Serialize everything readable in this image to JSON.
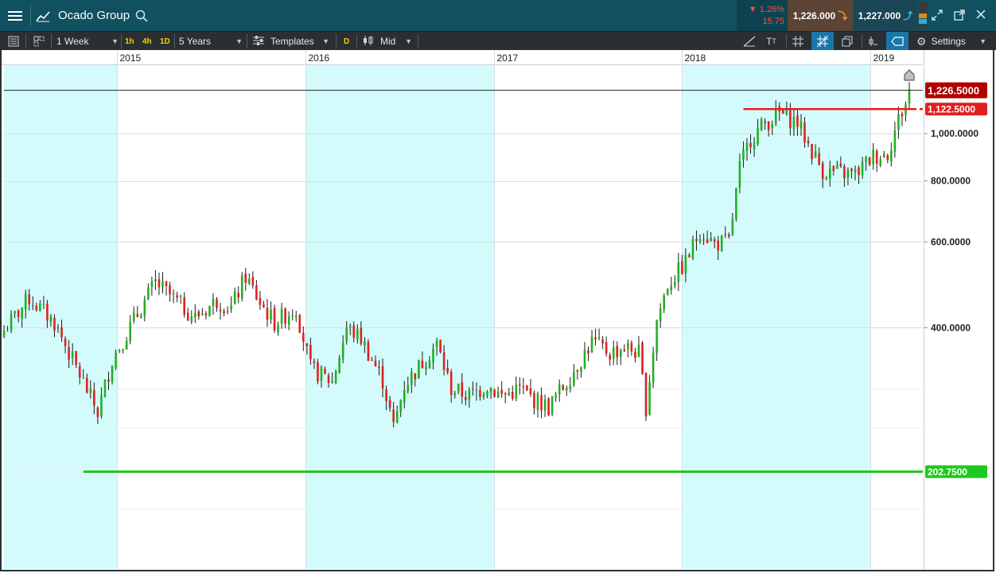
{
  "header": {
    "title": "Ocado Group",
    "change_percent": "▼ 1.26%",
    "change_value": "15.75",
    "sell_price": "1,226.000",
    "buy_price": "1,227.000"
  },
  "toolbar": {
    "period": "1 Week",
    "interval_1h": "1h",
    "interval_4h": "4h",
    "interval_1d": "1D",
    "range": "5 Years",
    "templates": "Templates",
    "d_label": "D",
    "price_type": "Mid",
    "settings": "Settings"
  },
  "colors": {
    "header_bg": "#11505f",
    "up": "#22b022",
    "down": "#e02020",
    "shade": "#d4fbfc",
    "support": "#1ec81e",
    "resistance": "#e02020",
    "current": "#b00000"
  },
  "chart_data": {
    "type": "candlestick",
    "title": "",
    "y_scale": "log",
    "ylim": [
      140,
      1400
    ],
    "y_ticks": [
      "1,000.0000",
      "800.0000",
      "600.0000",
      "400.0000"
    ],
    "y_tick_values": [
      1000,
      800,
      600,
      400
    ],
    "x_labels": [
      "2015",
      "2016",
      "2017",
      "2018",
      "2019"
    ],
    "x_label_dates": [
      "2015-01-01",
      "2016-01-01",
      "2017-01-01",
      "2018-01-01",
      "2019-01-01"
    ],
    "date_range": [
      "2014-05-26",
      "2019-03-18"
    ],
    "shaded_years": [
      "2016",
      "2018"
    ],
    "labels": {
      "current_price": "1,226.5000",
      "current_price_value": 1226.5,
      "resistance": "1,122.5000",
      "resistance_value": 1122.5,
      "support": "202.7500",
      "support_value": 202.75
    },
    "weekly_closes_anchor": [
      [
        "2014-05-26",
        395
      ],
      [
        "2014-07-14",
        460
      ],
      [
        "2014-09-01",
        410
      ],
      [
        "2014-10-20",
        320
      ],
      [
        "2014-11-24",
        268
      ],
      [
        "2014-12-22",
        345
      ],
      [
        "2015-02-16",
        440
      ],
      [
        "2015-03-16",
        495
      ],
      [
        "2015-05-04",
        445
      ],
      [
        "2015-06-01",
        420
      ],
      [
        "2015-07-13",
        455
      ],
      [
        "2015-08-10",
        440
      ],
      [
        "2015-09-07",
        510
      ],
      [
        "2015-10-05",
        450
      ],
      [
        "2015-11-02",
        410
      ],
      [
        "2015-12-14",
        440
      ],
      [
        "2016-01-11",
        330
      ],
      [
        "2016-02-22",
        310
      ],
      [
        "2016-03-21",
        400
      ],
      [
        "2016-04-18",
        380
      ],
      [
        "2016-05-30",
        312
      ],
      [
        "2016-06-20",
        250
      ],
      [
        "2016-07-11",
        305
      ],
      [
        "2016-08-15",
        340
      ],
      [
        "2016-09-12",
        370
      ],
      [
        "2016-10-10",
        300
      ],
      [
        "2016-11-14",
        290
      ],
      [
        "2016-12-19",
        305
      ],
      [
        "2017-01-16",
        290
      ],
      [
        "2017-02-20",
        300
      ],
      [
        "2017-03-20",
        285
      ],
      [
        "2017-04-17",
        275
      ],
      [
        "2017-05-22",
        310
      ],
      [
        "2017-06-19",
        345
      ],
      [
        "2017-07-10",
        375
      ],
      [
        "2017-08-14",
        355
      ],
      [
        "2017-09-11",
        365
      ],
      [
        "2017-10-09",
        355
      ],
      [
        "2017-10-23",
        275
      ],
      [
        "2017-11-13",
        415
      ],
      [
        "2017-12-04",
        490
      ],
      [
        "2018-01-08",
        545
      ],
      [
        "2018-02-05",
        635
      ],
      [
        "2018-03-05",
        595
      ],
      [
        "2018-04-02",
        600
      ],
      [
        "2018-04-23",
        850
      ],
      [
        "2018-05-14",
        980
      ],
      [
        "2018-06-11",
        1050
      ],
      [
        "2018-07-09",
        1100
      ],
      [
        "2018-08-13",
        1055
      ],
      [
        "2018-09-03",
        950
      ],
      [
        "2018-10-01",
        840
      ],
      [
        "2018-11-05",
        830
      ],
      [
        "2018-12-03",
        825
      ],
      [
        "2019-01-07",
        900
      ],
      [
        "2019-02-04",
        910
      ],
      [
        "2019-02-25",
        1070
      ],
      [
        "2019-03-11",
        1150
      ],
      [
        "2019-03-18",
        1226.5
      ]
    ]
  }
}
